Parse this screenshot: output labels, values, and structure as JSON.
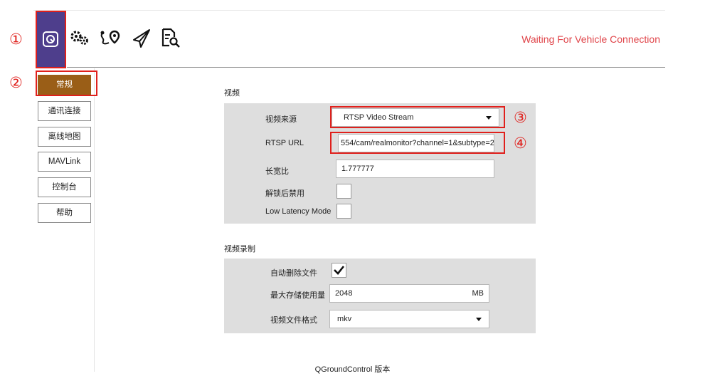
{
  "annotations": [
    "①",
    "②",
    "③",
    "④"
  ],
  "toolbar": {
    "status_text": "Waiting For Vehicle Connection",
    "icons": [
      "qgc-logo-icon",
      "gears-icon",
      "plan-route-icon",
      "paper-plane-icon",
      "analyze-icon"
    ]
  },
  "sidebar": {
    "items": [
      {
        "label": "常规",
        "active": true
      },
      {
        "label": "通讯连接"
      },
      {
        "label": "离线地图"
      },
      {
        "label": "MAVLink"
      },
      {
        "label": "控制台"
      },
      {
        "label": "帮助"
      }
    ]
  },
  "video": {
    "title": "视频",
    "source_label": "视频来源",
    "source_value": "RTSP Video Stream",
    "rtsp_label": "RTSP URL",
    "rtsp_value": "554/cam/realmonitor?channel=1&subtype=2",
    "aspect_label": "长宽比",
    "aspect_value": "1.777777",
    "disable_label": "解锁后禁用",
    "disable_checked": false,
    "low_latency_label": "Low Latency Mode",
    "low_latency_checked": false
  },
  "recording": {
    "title": "视频录制",
    "auto_delete_label": "自动删除文件",
    "auto_delete_checked": true,
    "max_storage_label": "最大存储使用量",
    "max_storage_value": "2048",
    "max_storage_unit": "MB",
    "format_label": "视频文件格式",
    "format_value": "mkv"
  },
  "footer": {
    "version_label": "QGroundControl 版本"
  },
  "colors": {
    "accent": "#9a5e17",
    "toolbar_active": "#4e3e8c",
    "status": "#e0454a",
    "annotation": "#e0201c"
  }
}
